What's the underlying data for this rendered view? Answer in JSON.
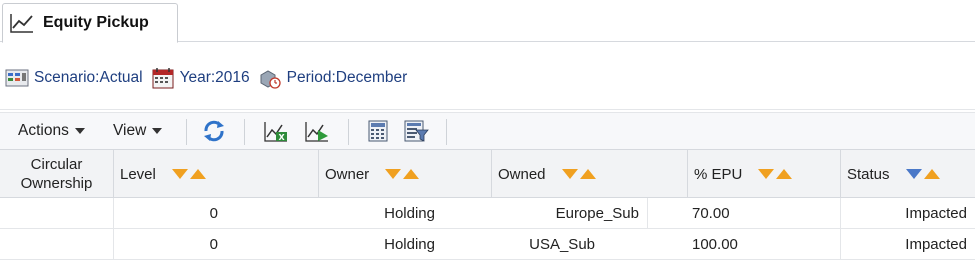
{
  "tab": {
    "label": "Equity Pickup",
    "icon": "line-chart-icon"
  },
  "pov": {
    "scenario": "Scenario:Actual",
    "year": "Year:2016",
    "period": "Period:December"
  },
  "toolbar": {
    "actions_label": "Actions",
    "view_label": "View",
    "buttons": [
      "refresh-icon",
      "export-excel-icon",
      "run-calc-icon",
      "calculator-icon",
      "filter-form-icon"
    ]
  },
  "grid": {
    "columns": [
      "Circular Ownership",
      "Level",
      "Owner",
      "Owned",
      "% EPU",
      "Status"
    ],
    "rows": [
      {
        "circular": "",
        "level": "0",
        "owner": "Holding",
        "owned": "Europe_Sub",
        "epu": "70.00",
        "status": "Impacted"
      },
      {
        "circular": "",
        "level": "0",
        "owner": "Holding",
        "owned": "USA_Sub",
        "epu": "100.00",
        "status": "Impacted"
      }
    ]
  },
  "colors": {
    "link": "#1f3f80",
    "sort_arrow": "#f0a020",
    "header_bg": "#f2f3f5"
  }
}
